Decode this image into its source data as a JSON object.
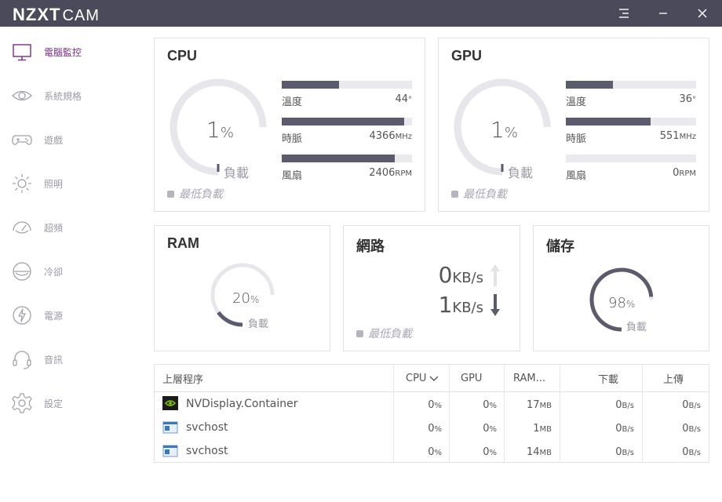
{
  "titlebar": {
    "brand": "NZXT",
    "app": "CAM",
    "menu_icon": "hamburger-menu-icon",
    "minimize_icon": "minimize-icon",
    "close_icon": "close-icon"
  },
  "sidebar": {
    "items": [
      {
        "label": "電腦監控",
        "icon": "monitor-icon",
        "active": true
      },
      {
        "label": "系統規格",
        "icon": "eye-icon"
      },
      {
        "label": "遊戲",
        "icon": "gamepad-icon"
      },
      {
        "label": "照明",
        "icon": "sun-icon"
      },
      {
        "label": "超頻",
        "icon": "speedometer-icon"
      },
      {
        "label": "冷卻",
        "icon": "cooling-icon"
      },
      {
        "label": "電源",
        "icon": "lightning-icon"
      },
      {
        "label": "音訊",
        "icon": "headset-icon"
      },
      {
        "label": "設定",
        "icon": "gear-icon"
      }
    ]
  },
  "cpu": {
    "title": "CPU",
    "load_value": "1",
    "load_unit": "%",
    "load_label": "負載",
    "min_load": "最低負載",
    "temp_label": "溫度",
    "temp_value": "44",
    "temp_unit": "°",
    "temp_fill": 0.44,
    "clock_label": "時脈",
    "clock_value": "4366",
    "clock_unit": "MHz",
    "clock_fill": 0.94,
    "fan_label": "風扇",
    "fan_value": "2406",
    "fan_unit": "RPM",
    "fan_fill": 0.87
  },
  "gpu": {
    "title": "GPU",
    "load_value": "1",
    "load_unit": "%",
    "load_label": "負載",
    "min_load": "最低負載",
    "temp_label": "溫度",
    "temp_value": "36",
    "temp_unit": "°",
    "temp_fill": 0.36,
    "clock_label": "時脈",
    "clock_value": "551",
    "clock_unit": "MHz",
    "clock_fill": 0.65,
    "fan_label": "風扇",
    "fan_value": "0",
    "fan_unit": "RPM",
    "fan_fill": 0.0
  },
  "ram": {
    "title": "RAM",
    "load_value": "20",
    "load_unit": "%",
    "load_label": "負載"
  },
  "network": {
    "title": "網路",
    "up_value": "0",
    "up_unit": "KB/s",
    "down_value": "1",
    "down_unit": "KB/s",
    "min_load": "最低負載"
  },
  "storage": {
    "title": "儲存",
    "load_value": "98",
    "load_unit": "%",
    "load_label": "負載"
  },
  "table": {
    "headers": {
      "process": "上層程序",
      "cpu": "CPU",
      "gpu": "GPU",
      "ram": "RAM...",
      "download": "下載",
      "upload": "上傳"
    },
    "rows": [
      {
        "name": "NVDisplay.Container",
        "icon": "nvidia-icon",
        "cpu": "0",
        "gpu": "0",
        "ram": "17",
        "download": "0",
        "upload": "0"
      },
      {
        "name": "svchost",
        "icon": "window-icon",
        "cpu": "0",
        "gpu": "0",
        "ram": "1",
        "download": "0",
        "upload": "0"
      },
      {
        "name": "svchost",
        "icon": "window-icon",
        "cpu": "0",
        "gpu": "0",
        "ram": "14",
        "download": "0",
        "upload": "0"
      }
    ],
    "pct_unit": "%",
    "ram_unit": "MB",
    "rate_unit": "B/s"
  },
  "colors": {
    "titlebar": "#4a4a5a",
    "accent": "#7a2b86",
    "gauge_track": "#e6e6eb",
    "gauge_fill": "#5b5b6d"
  }
}
